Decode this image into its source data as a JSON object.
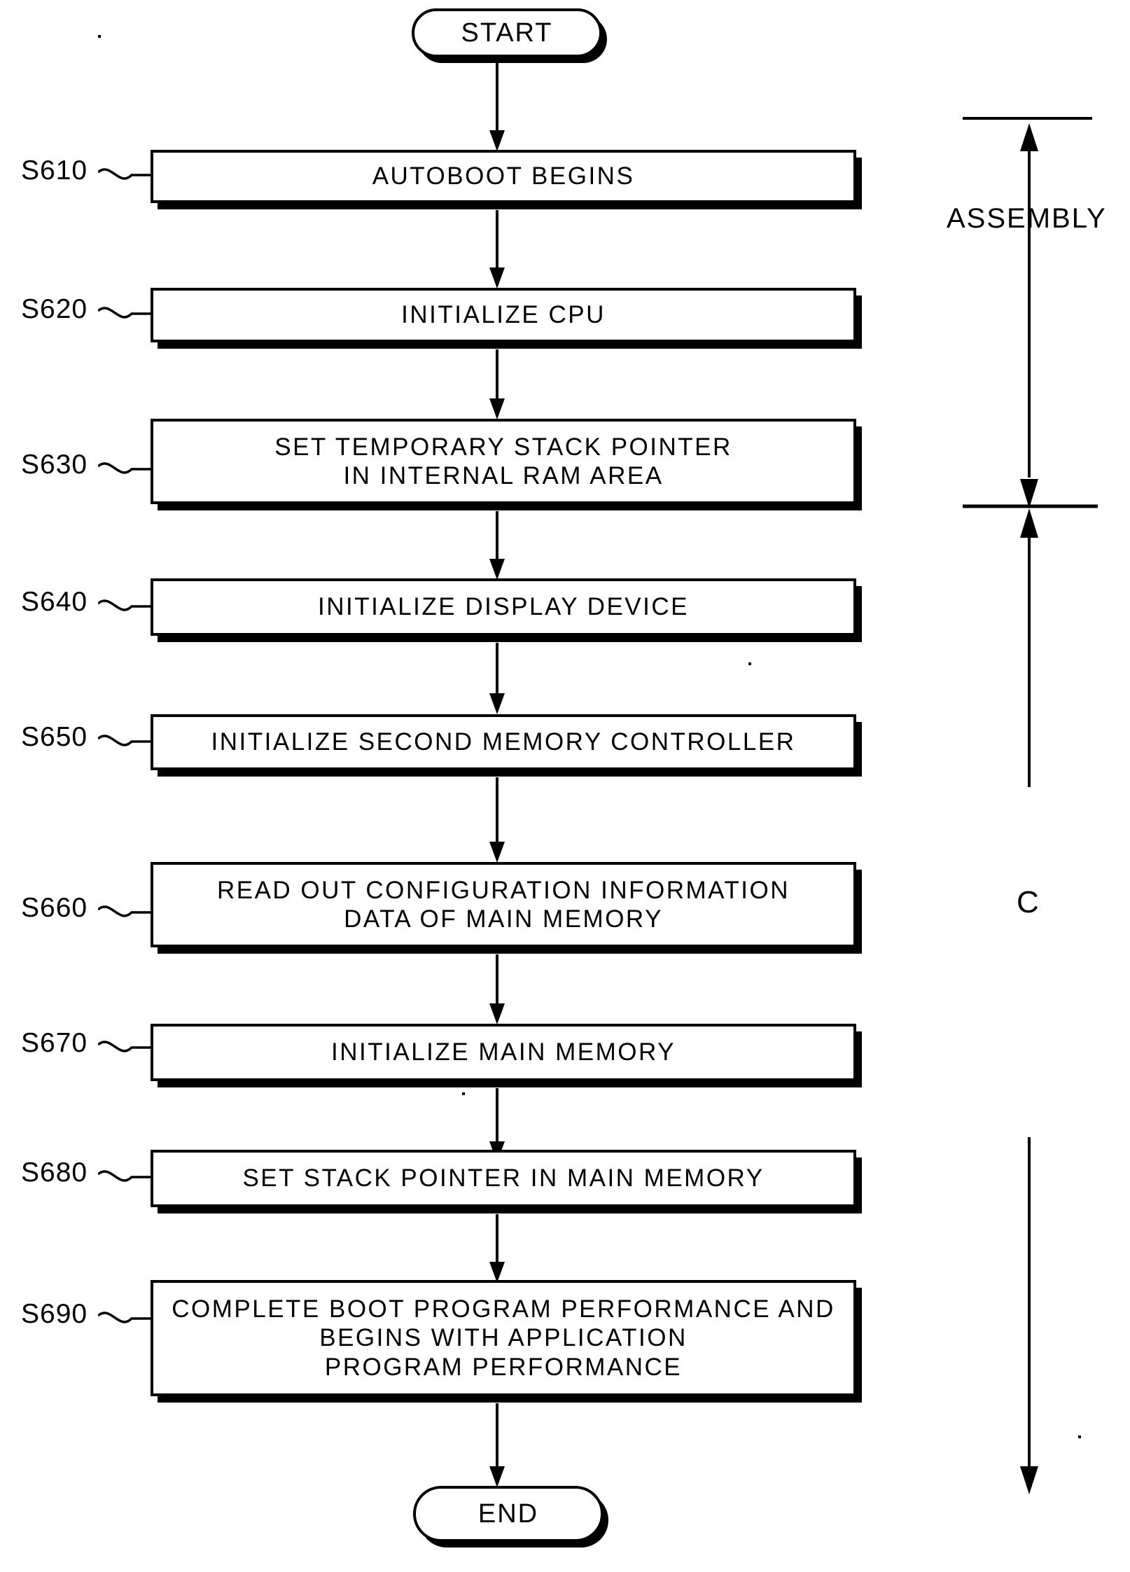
{
  "diagram": {
    "title": "Boot sequence flowchart",
    "start_label": "START",
    "end_label": "END",
    "steps": [
      {
        "id": "S610",
        "text": "AUTOBOOT BEGINS"
      },
      {
        "id": "S620",
        "text": "INITIALIZE CPU"
      },
      {
        "id": "S630",
        "text": "SET TEMPORARY STACK POINTER\nIN INTERNAL RAM AREA"
      },
      {
        "id": "S640",
        "text": "INITIALIZE DISPLAY DEVICE"
      },
      {
        "id": "S650",
        "text": "INITIALIZE SECOND MEMORY CONTROLLER"
      },
      {
        "id": "S660",
        "text": "READ OUT CONFIGURATION INFORMATION\nDATA OF MAIN MEMORY"
      },
      {
        "id": "S670",
        "text": "INITIALIZE MAIN MEMORY"
      },
      {
        "id": "S680",
        "text": "SET STACK POINTER IN MAIN MEMORY"
      },
      {
        "id": "S690",
        "text": "COMPLETE BOOT PROGRAM PERFORMANCE AND\nBEGINS WITH APPLICATION\nPROGRAM PERFORMANCE"
      }
    ],
    "side_brackets": [
      {
        "label": "ASSEMBLY"
      },
      {
        "label": "C"
      }
    ],
    "colors": {
      "ink": "#000000",
      "paper": "#ffffff"
    }
  }
}
